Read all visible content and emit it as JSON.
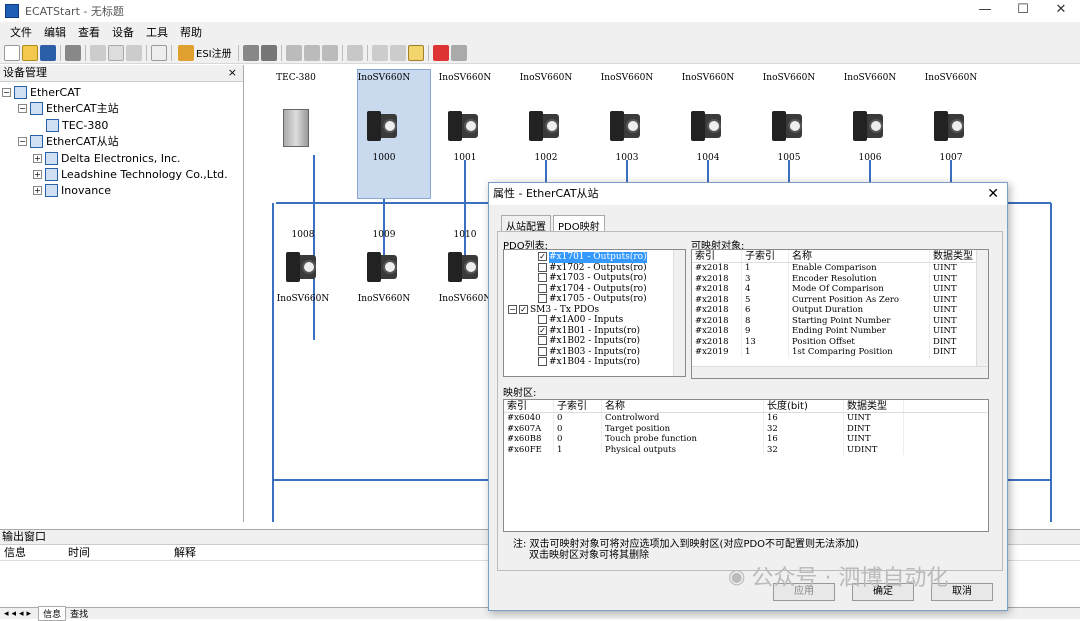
{
  "window": {
    "title": "ECATStart - 无标题",
    "controls": [
      "—",
      "☐",
      "✕"
    ]
  },
  "menu": [
    "文件",
    "编辑",
    "查看",
    "设备",
    "工具",
    "帮助"
  ],
  "toolbar": {
    "esi_label": "ESI注册"
  },
  "device_panel": {
    "title": "设备管理",
    "close": "×",
    "tree": [
      {
        "label": "EtherCAT",
        "level": 0,
        "expander": "−"
      },
      {
        "label": "EtherCAT主站",
        "level": 1,
        "expander": "−"
      },
      {
        "label": "TEC-380",
        "level": 2,
        "expander": ""
      },
      {
        "label": "EtherCAT从站",
        "level": 1,
        "expander": "−"
      },
      {
        "label": "Delta Electronics, Inc.",
        "level": 2,
        "expander": "+"
      },
      {
        "label": "Leadshine Technology Co.,Ltd.",
        "level": 2,
        "expander": "+"
      },
      {
        "label": "Inovance",
        "level": 2,
        "expander": "+"
      }
    ]
  },
  "canvas": {
    "top_names": [
      "TEC-380",
      "InoSV660N",
      "InoSV660N",
      "InoSV660N",
      "InoSV660N",
      "InoSV660N",
      "InoSV660N",
      "InoSV660N",
      "InoSV660N"
    ],
    "top_numbers": [
      "",
      "1000",
      "1001",
      "1002",
      "1003",
      "1004",
      "1005",
      "1006",
      "1007"
    ],
    "bottom_numbers": [
      "1008",
      "1009",
      "1010"
    ],
    "bottom_names": [
      "InoSV660N",
      "InoSV660N",
      "InoSV660N"
    ]
  },
  "output_panel": {
    "title": "输出窗口",
    "columns": [
      "信息",
      "时间",
      "解释"
    ],
    "tabs": [
      "信息",
      "查找"
    ]
  },
  "dialog": {
    "title": "属性 - EtherCAT从站",
    "close": "✕",
    "tabs": [
      "从站配置",
      "PDO映射"
    ],
    "pdo_list_label": "PDO列表:",
    "pdo_items": [
      {
        "text": "#x1701 - Outputs(ro)",
        "checked": true,
        "selected": true,
        "indent": 2
      },
      {
        "text": "#x1702 - Outputs(ro)",
        "checked": false,
        "selected": false,
        "indent": 2
      },
      {
        "text": "#x1703 - Outputs(ro)",
        "checked": false,
        "selected": false,
        "indent": 2
      },
      {
        "text": "#x1704 - Outputs(ro)",
        "checked": false,
        "selected": false,
        "indent": 2
      },
      {
        "text": "#x1705 - Outputs(ro)",
        "checked": false,
        "selected": false,
        "indent": 2
      },
      {
        "text": "SM3 - Tx PDOs",
        "checked": true,
        "selected": false,
        "indent": 0
      },
      {
        "text": "#x1A00 - Inputs",
        "checked": false,
        "selected": false,
        "indent": 2
      },
      {
        "text": "#x1B01 - Inputs(ro)",
        "checked": true,
        "selected": false,
        "indent": 2
      },
      {
        "text": "#x1B02 - Inputs(ro)",
        "checked": false,
        "selected": false,
        "indent": 2
      },
      {
        "text": "#x1B03 - Inputs(ro)",
        "checked": false,
        "selected": false,
        "indent": 2
      },
      {
        "text": "#x1B04 - Inputs(ro)",
        "checked": false,
        "selected": false,
        "indent": 2
      }
    ],
    "mappable_label": "可映射对象:",
    "mappable_headers": [
      "索引",
      "子索引",
      "名称",
      "数据类型"
    ],
    "mappable_rows": [
      [
        "#x2018",
        "1",
        "Enable Comparison",
        "UINT"
      ],
      [
        "#x2018",
        "3",
        "Encoder Resolution",
        "UINT"
      ],
      [
        "#x2018",
        "4",
        "Mode Of Comparison",
        "UINT"
      ],
      [
        "#x2018",
        "5",
        "Current Position As Zero",
        "UINT"
      ],
      [
        "#x2018",
        "6",
        "Output Duration",
        "UINT"
      ],
      [
        "#x2018",
        "8",
        "Starting Point Number",
        "UINT"
      ],
      [
        "#x2018",
        "9",
        "Ending Point Number",
        "UINT"
      ],
      [
        "#x2018",
        "13",
        "Position Offset",
        "DINT"
      ],
      [
        "#x2019",
        "1",
        "1st Comparing Position",
        "DINT"
      ]
    ],
    "mapped_label": "映射区:",
    "mapped_headers": [
      "索引",
      "子索引",
      "名称",
      "长度(bit)",
      "数据类型"
    ],
    "mapped_rows": [
      [
        "#x6040",
        "0",
        "Controlword",
        "16",
        "UINT"
      ],
      [
        "#x607A",
        "0",
        "Target position",
        "32",
        "DINT"
      ],
      [
        "#x60B8",
        "0",
        "Touch probe function",
        "16",
        "UINT"
      ],
      [
        "#x60FE",
        "1",
        "Physical outputs",
        "32",
        "UDINT"
      ]
    ],
    "note_line1": "注: 双击可映射对象可将对应选项加入到映射区(对应PDO不可配置则无法添加)",
    "note_line2": "双击映射区对象可将其删除",
    "buttons": {
      "apply": "应用",
      "ok": "确定",
      "cancel": "取消"
    }
  },
  "watermark": "公众号 · 泗博自动化"
}
